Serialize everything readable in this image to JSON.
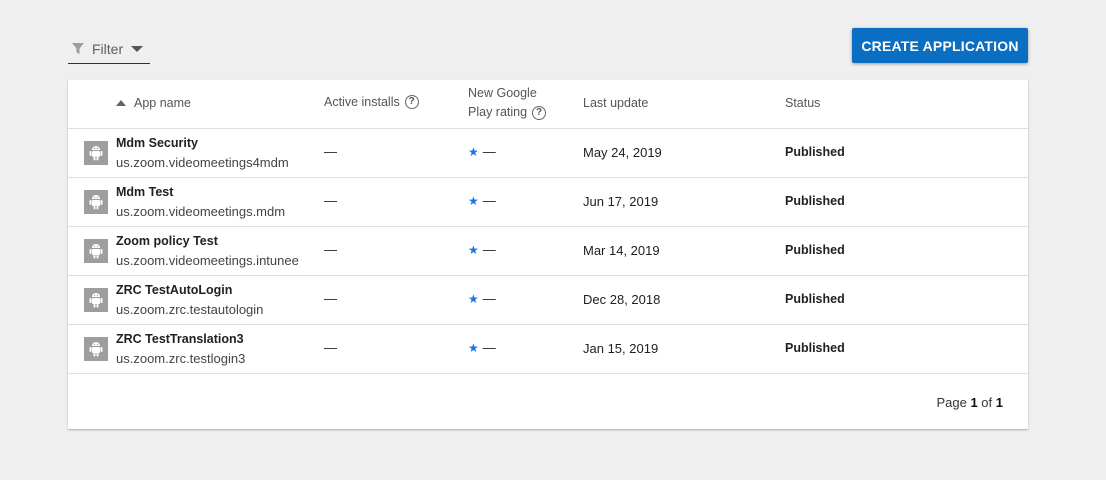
{
  "toolbar": {
    "filter_label": "Filter",
    "create_label": "CREATE APPLICATION"
  },
  "table": {
    "headers": {
      "app_name": "App name",
      "active_installs": "Active installs",
      "rating_line1": "New Google",
      "rating_line2": "Play rating",
      "last_update": "Last update",
      "status": "Status"
    },
    "rows": [
      {
        "name": "Mdm Security",
        "package": "us.zoom.videomeetings4mdm",
        "installs": "—",
        "rating": "—",
        "updated": "May 24, 2019",
        "status": "Published"
      },
      {
        "name": "Mdm Test",
        "package": "us.zoom.videomeetings.mdm",
        "installs": "—",
        "rating": "—",
        "updated": "Jun 17, 2019",
        "status": "Published"
      },
      {
        "name": "Zoom policy Test",
        "package": "us.zoom.videomeetings.intunee",
        "installs": "—",
        "rating": "—",
        "updated": "Mar 14, 2019",
        "status": "Published"
      },
      {
        "name": "ZRC TestAutoLogin",
        "package": "us.zoom.zrc.testautologin",
        "installs": "—",
        "rating": "—",
        "updated": "Dec 28, 2018",
        "status": "Published"
      },
      {
        "name": "ZRC TestTranslation3",
        "package": "us.zoom.zrc.testlogin3",
        "installs": "—",
        "rating": "—",
        "updated": "Jan 15, 2019",
        "status": "Published"
      }
    ]
  },
  "pager": {
    "prefix": "Page",
    "current": "1",
    "of": "of",
    "total": "1"
  },
  "colors": {
    "accent": "#0a6fc2",
    "star": "#1a73e8",
    "background": "#efefef"
  }
}
